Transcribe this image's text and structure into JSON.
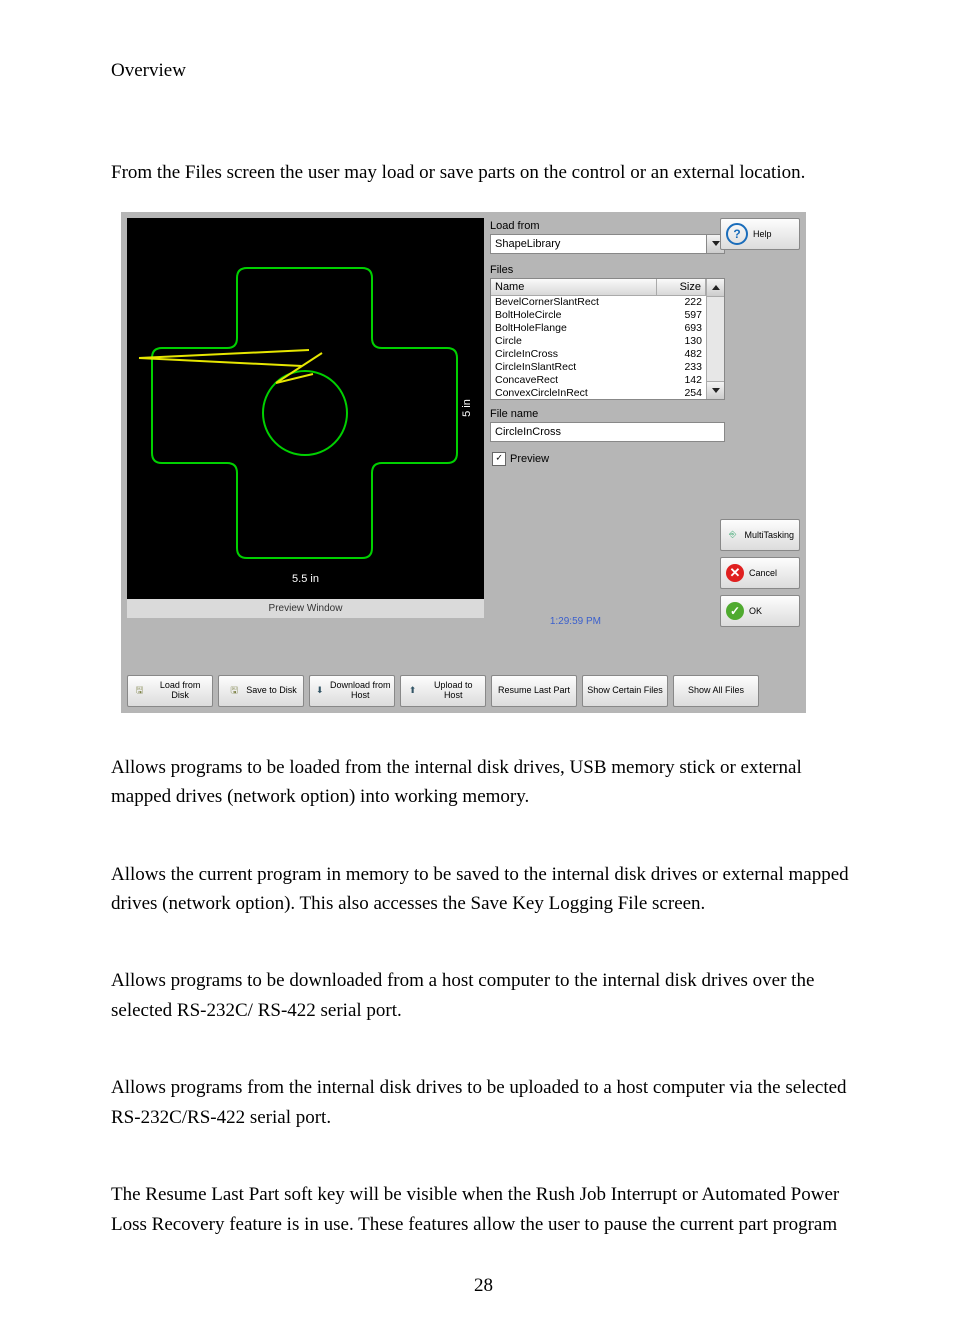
{
  "page_heading": "Overview",
  "intro": "From the Files screen the user may load or save parts on the control or an external location.",
  "page_number": "28",
  "paragraphs": {
    "p1": "Allows programs to be loaded from the internal disk drives, USB memory stick or external mapped drives (network option) into working memory.",
    "p2": "Allows the current program in memory to be saved to the internal disk drives or external mapped drives (network option).  This also accesses the Save Key Logging File screen.",
    "p3": "Allows programs to be downloaded from a host computer to the internal disk drives over the selected RS-232C/ RS-422 serial port.",
    "p4": "Allows programs from the internal disk drives to be uploaded to a host computer via the selected RS-232C/RS-422 serial port.",
    "p5": "The Resume Last Part soft key will be visible when the Rush Job Interrupt or Automated Power Loss Recovery feature is in use.  These features allow the user to pause the current part program"
  },
  "screenshot": {
    "load_from_label": "Load from",
    "load_from_value": "ShapeLibrary",
    "files_label": "Files",
    "file_name_label": "File name",
    "file_name_value": "CircleInCross",
    "preview_checkbox": "Preview",
    "preview_window_label": "Preview Window",
    "timestamp": "1:29:59 PM",
    "dim_h": "5.5 in",
    "dim_v": "5 in",
    "columns": {
      "name": "Name",
      "size": "Size"
    },
    "files": [
      {
        "name": "BevelCornerSlantRect",
        "size": "222"
      },
      {
        "name": "BoltHoleCircle",
        "size": "597"
      },
      {
        "name": "BoltHoleFlange",
        "size": "693"
      },
      {
        "name": "Circle",
        "size": "130"
      },
      {
        "name": "CircleInCross",
        "size": "482"
      },
      {
        "name": "CircleInSlantRect",
        "size": "233"
      },
      {
        "name": "ConcaveRect",
        "size": "142"
      },
      {
        "name": "ConvexCircleInRect",
        "size": "254"
      }
    ],
    "right_buttons": {
      "help": "Help",
      "multitasking": "MultiTasking",
      "cancel": "Cancel",
      "ok": "OK"
    },
    "bottom_buttons": {
      "load_from_disk": "Load from Disk",
      "save_to_disk": "Save to Disk",
      "download_from_host": "Download from Host",
      "upload_to_host": "Upload to Host",
      "resume_last_part": "Resume Last Part",
      "show_certain_files": "Show Certain Files",
      "show_all_files": "Show All Files"
    }
  }
}
